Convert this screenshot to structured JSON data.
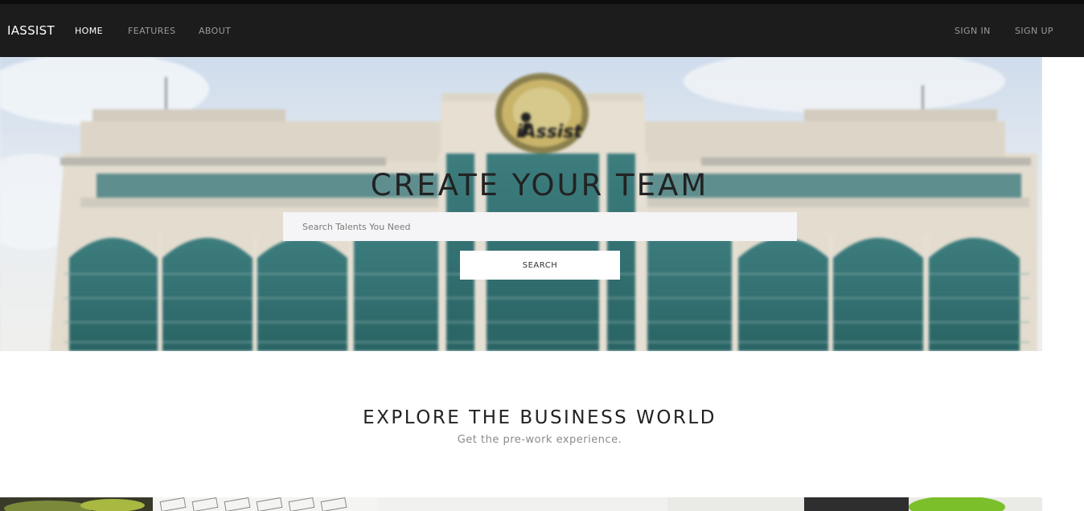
{
  "brand": "IASSIST",
  "nav": {
    "home": "HOME",
    "features": "FEATURES",
    "about": "ABOUT",
    "sign_in": "SIGN IN",
    "sign_up": "SIGN UP"
  },
  "hero": {
    "title": "CREATE YOUR TEAM",
    "search_placeholder": "Search Talents You Need",
    "search_value": "",
    "search_button": "SEARCH",
    "logo_text": "iAssist"
  },
  "section": {
    "title": "EXPLORE THE BUSINESS WORLD",
    "subtitle": "Get the pre-work experience."
  },
  "colors": {
    "navbar": "#1c1c1c",
    "nav_active": "#ffffff",
    "nav_inactive": "#9a9a9a",
    "building": "#ddd6c8",
    "windows": "#2f6f70"
  },
  "icons": {
    "logo": "iassist-seal-logo"
  }
}
